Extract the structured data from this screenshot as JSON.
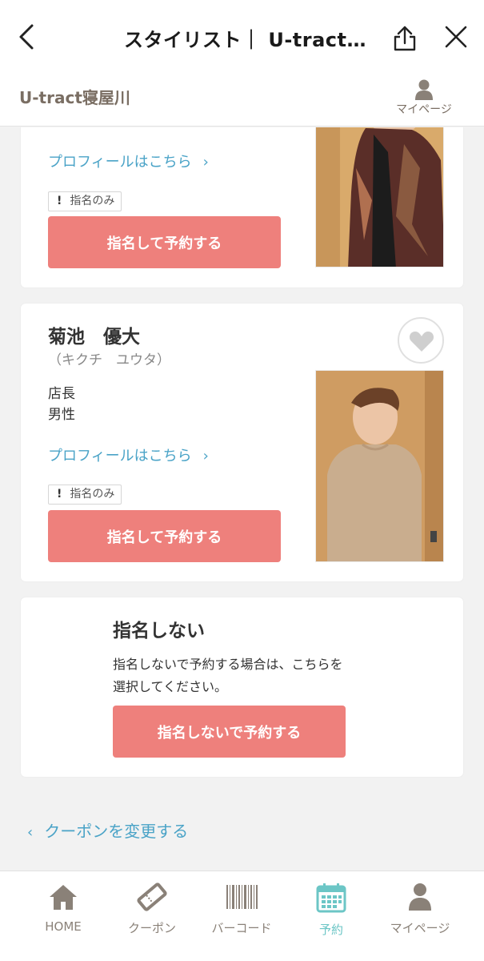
{
  "topnav": {
    "title": "スタイリスト｜ U-tract…"
  },
  "shop": {
    "name": "U-tract寝屋川",
    "mypage_label": "マイページ"
  },
  "stylists": [
    {
      "name": "",
      "kana": "",
      "profile_link": "プロフィールはこちら",
      "badge": "指名のみ",
      "reserve_button": "指名して予約する"
    },
    {
      "name": "菊池　優大",
      "kana": "（キクチ　ユウタ）",
      "role": "店長",
      "gender": "男性",
      "profile_link": "プロフィールはこちら",
      "badge": "指名のみ",
      "reserve_button": "指名して予約する"
    }
  ],
  "no_select": {
    "title": "指名しない",
    "text": "指名しないで予約する場合は、こちらを選択してください。",
    "button": "指名しないで予約する"
  },
  "coupon_link": "クーポンを変更する",
  "tabbar": {
    "items": [
      {
        "label": "HOME",
        "icon": "home-icon"
      },
      {
        "label": "クーポン",
        "icon": "ticket-icon"
      },
      {
        "label": "バーコード",
        "icon": "barcode-icon"
      },
      {
        "label": "予約",
        "icon": "calendar-icon",
        "active": true
      },
      {
        "label": "マイページ",
        "icon": "person-icon"
      }
    ]
  },
  "colors": {
    "accent_button": "#ee807c",
    "link": "#4aa3c7",
    "active_tab": "#6cc6c6",
    "brand_text": "#7a6e63"
  }
}
